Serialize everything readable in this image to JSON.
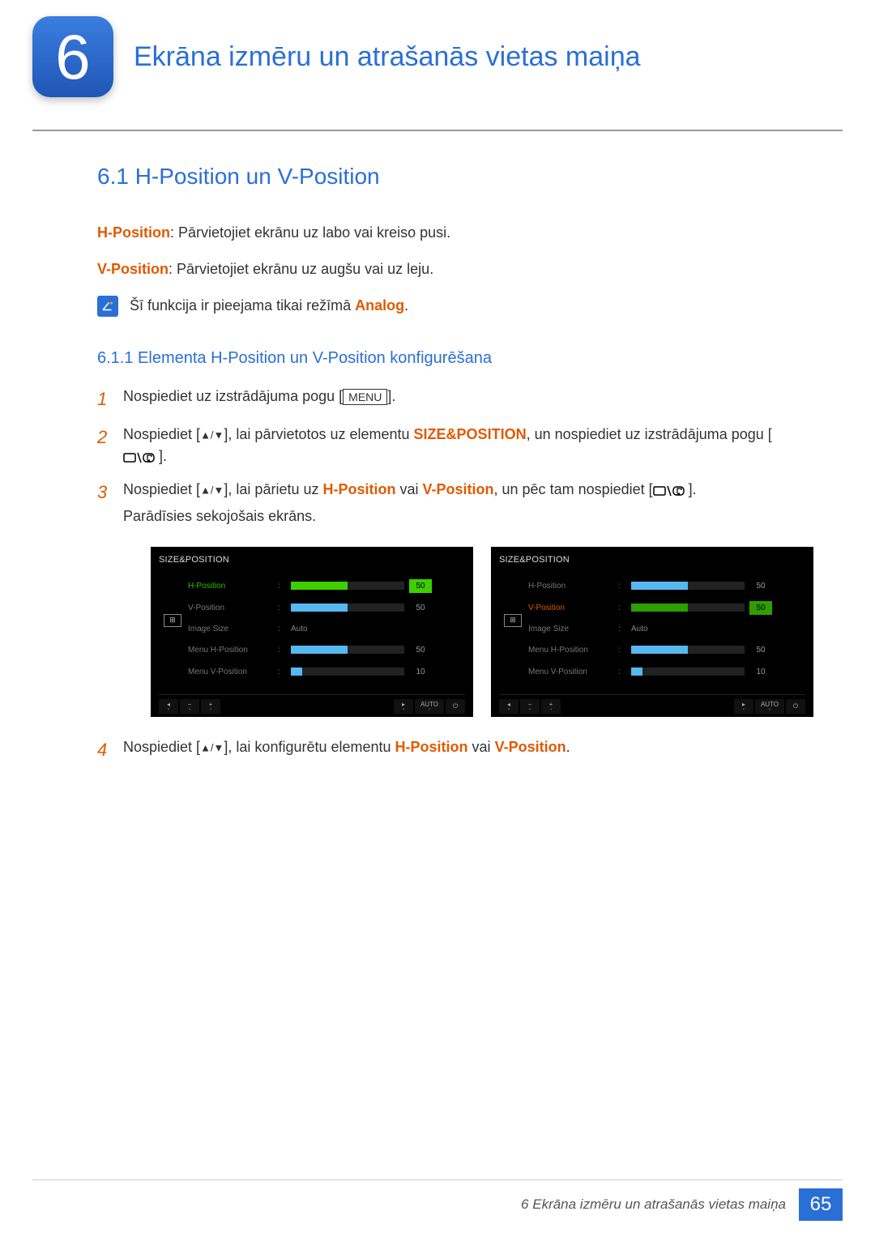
{
  "chapter": {
    "number": "6",
    "title": "Ekrāna izmēru un atrašanās vietas maiņa"
  },
  "section": {
    "number_title": "6.1   H-Position un V-Position"
  },
  "hpos": {
    "label": "H-Position",
    "desc": ": Pārvietojiet ekrānu uz labo vai kreiso pusi."
  },
  "vpos": {
    "label": "V-Position",
    "desc": ": Pārvietojiet ekrānu uz augšu vai uz leju."
  },
  "note": {
    "pre": "Šī funkcija ir pieejama tikai režīmā ",
    "mode": "Analog",
    "suf": "."
  },
  "subsection": {
    "title": "6.1.1   Elementa H-Position un V-Position konfigurēšana"
  },
  "steps": {
    "s1": {
      "num": "1",
      "a": "Nospiediet uz izstrādājuma pogu [",
      "menu": "MENU",
      "b": "]."
    },
    "s2": {
      "num": "2",
      "a": "Nospiediet [",
      "b": "], lai pārvietotos uz elementu ",
      "term": "SIZE&POSITION",
      "c": ", un nospiediet uz izstrādājuma pogu [",
      "d": "]."
    },
    "s3": {
      "num": "3",
      "a": "Nospiediet [",
      "b": "], lai pārietu uz ",
      "h": "H-Position",
      "mid": " vai ",
      "v": "V-Position",
      "c": ", un pēc tam nospiediet [",
      "d": "].",
      "e": "Parādīsies sekojošais ekrāns."
    },
    "s4": {
      "num": "4",
      "a": "Nospiediet [",
      "b": "], lai konfigurētu elementu ",
      "h": "H-Position",
      "mid": " vai ",
      "v": "V-Position",
      "c": "."
    }
  },
  "osd": {
    "title": "SIZE&POSITION",
    "rows": {
      "hp": {
        "label": "H-Position",
        "val": "50"
      },
      "vp": {
        "label": "V-Position",
        "val": "50"
      },
      "img": {
        "label": "Image Size",
        "val": "Auto"
      },
      "mhp": {
        "label": "Menu H-Position",
        "val": "50"
      },
      "mvp": {
        "label": "Menu V-Position",
        "val": "10"
      }
    },
    "foot": {
      "auto": "AUTO"
    }
  },
  "footer": {
    "text": "6 Ekrāna izmēru un atrašanās vietas maiņa",
    "page": "65"
  }
}
